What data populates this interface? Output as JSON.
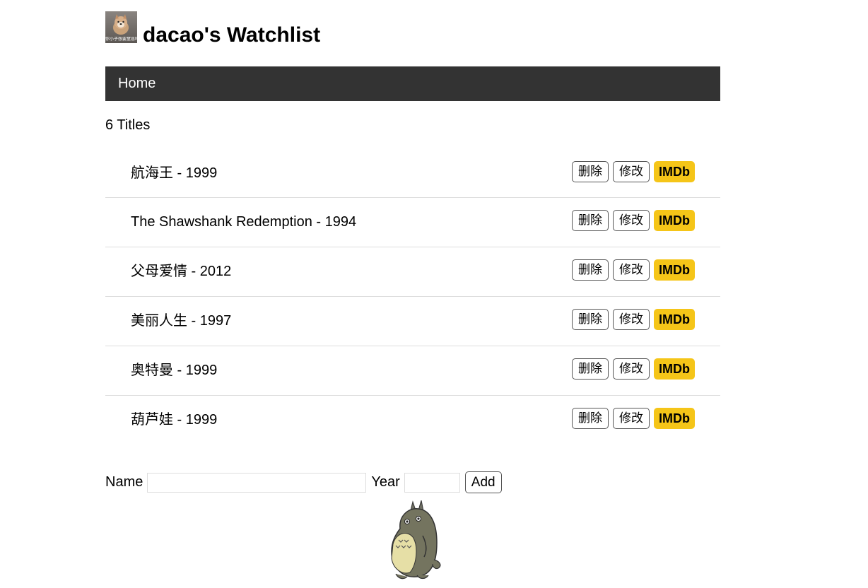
{
  "header": {
    "title": "dacao's Watchlist",
    "avatar_caption": "你小子想要窒息吗"
  },
  "nav": {
    "home_label": "Home"
  },
  "count_label": "6 Titles",
  "movies": [
    {
      "text": "航海王 - 1999"
    },
    {
      "text": "The Shawshank Redemption - 1994"
    },
    {
      "text": "父母爱情 - 2012"
    },
    {
      "text": "美丽人生 - 1997"
    },
    {
      "text": "奥特曼 - 1999"
    },
    {
      "text": "葫芦娃 - 1999"
    }
  ],
  "actions": {
    "delete_label": "删除",
    "edit_label": "修改",
    "imdb_label": "IMDb"
  },
  "form": {
    "name_label": "Name",
    "name_value": "",
    "year_label": "Year",
    "year_value": "",
    "add_label": "Add"
  },
  "colors": {
    "nav_bg": "#333333",
    "imdb_bg": "#f5c518",
    "divider": "#dddddd"
  },
  "icons": {
    "avatar": "shiba-dog-avatar",
    "footer": "totoro-illustration"
  }
}
